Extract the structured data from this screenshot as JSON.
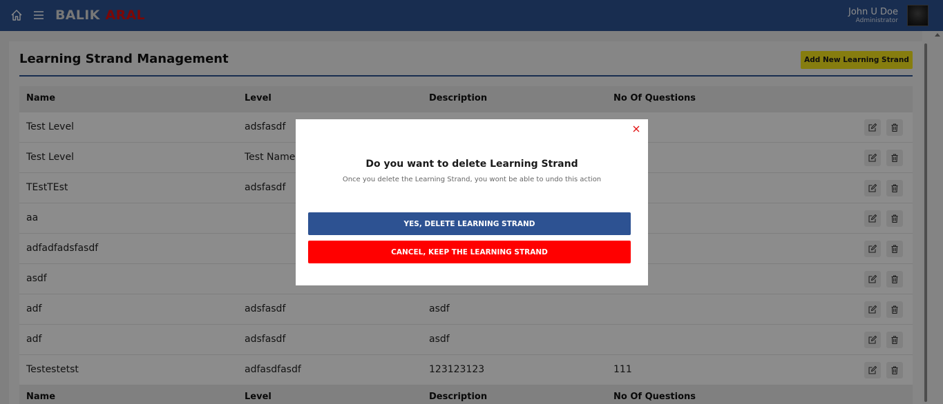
{
  "navbar": {
    "brand_part1": "BALIK",
    "brand_part2": "ARAL",
    "user_name": "John U Doe",
    "user_role": "Administrator"
  },
  "page": {
    "title": "Learning Strand Management",
    "add_button_label": "Add New Learning Strand"
  },
  "table": {
    "columns": [
      "Name",
      "Level",
      "Description",
      "No Of Questions"
    ],
    "rows": [
      {
        "name": "Test Level",
        "level": "adsfasdf",
        "description": "",
        "questions": ""
      },
      {
        "name": "Test Level",
        "level": "Test Name",
        "description": "",
        "questions": ""
      },
      {
        "name": "TEstTEst",
        "level": "adsfasdf",
        "description": "",
        "questions": ""
      },
      {
        "name": "aa",
        "level": "",
        "description": "",
        "questions": ""
      },
      {
        "name": "adfadfadsfasdf",
        "level": "",
        "description": "",
        "questions": ""
      },
      {
        "name": "asdf",
        "level": "",
        "description": "",
        "questions": ""
      },
      {
        "name": "adf",
        "level": "adsfasdf",
        "description": "asdf",
        "questions": ""
      },
      {
        "name": "adf",
        "level": "adsfasdf",
        "description": "asdf",
        "questions": ""
      },
      {
        "name": "Testestetst",
        "level": "adfasdfasdf",
        "description": "123123123",
        "questions": "111"
      }
    ],
    "footer_columns": [
      "Name",
      "Level",
      "Description",
      "No Of Questions"
    ]
  },
  "modal": {
    "title": "Do you want to delete Learning Strand",
    "subtitle": "Once you delete the Learning Strand, you wont be able to undo this action",
    "confirm_label": "YES, DELETE LEARNING STRAND",
    "cancel_label": "CANCEL, KEEP THE LEARNING STRAND"
  },
  "colors": {
    "primary": "#2d5292",
    "accent_red": "#ff0000",
    "add_button": "#f5e31c",
    "brand_red": "#e10d0d"
  },
  "icons": {
    "home": "home-icon",
    "menu": "hamburger-icon",
    "edit": "edit-icon",
    "delete": "trash-icon",
    "close": "close-icon"
  }
}
